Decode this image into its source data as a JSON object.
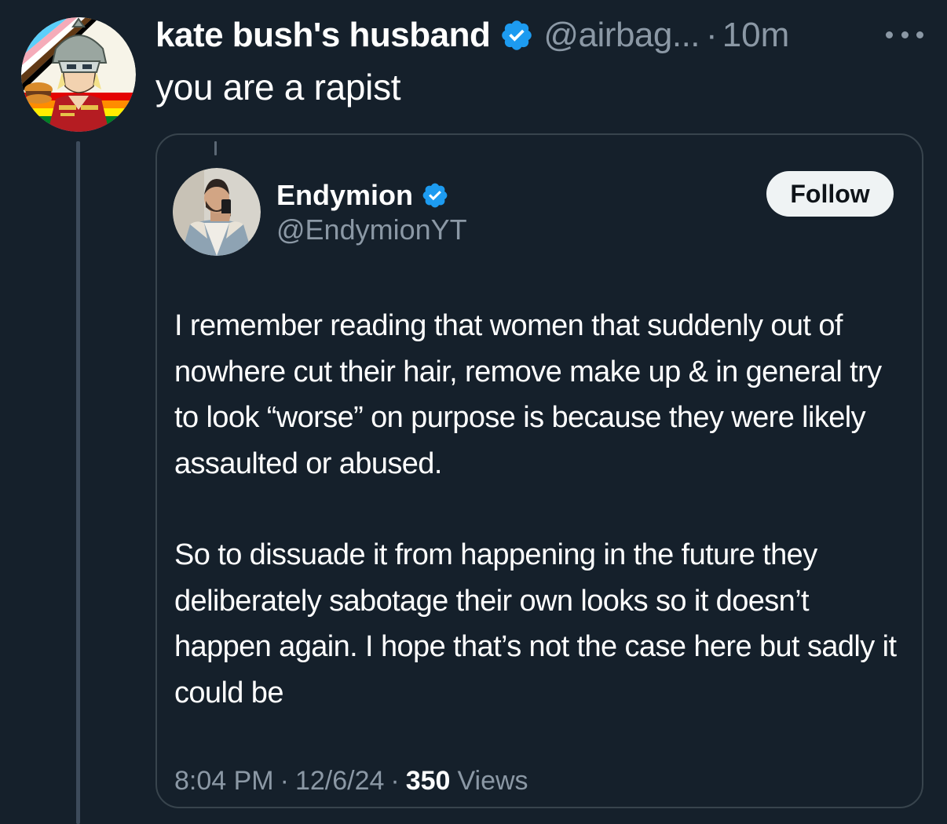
{
  "reply_tweet": {
    "author_name": "kate bush's husband",
    "handle": "@airbag...",
    "separator": "·",
    "time": "10m",
    "text": "you are a rapist"
  },
  "quoted_tweet": {
    "author_name": "Endymion",
    "handle": "@EndymionYT",
    "follow_label": "Follow",
    "paragraphs": [
      "I remember reading that women that suddenly out of nowhere cut their hair, remove make up & in general try to look “worse” on purpose is because they were likely assaulted or abused.",
      "So to dissuade it from happening in the future they deliberately sabotage their own looks so it doesn’t happen again. I hope that’s not the case here but sadly it could be"
    ],
    "time": "8:04 PM",
    "separator": "·",
    "date": "12/6/24",
    "views_count": "350",
    "views_label": "Views"
  },
  "icons": {
    "verified": "verified-badge-icon",
    "more": "more-horizontal-icon"
  },
  "colors": {
    "background": "#15202b",
    "verified_blue": "#1d9bf0",
    "secondary_text": "#8b98a5",
    "border": "#38444d",
    "follow_bg": "#eff3f4"
  }
}
